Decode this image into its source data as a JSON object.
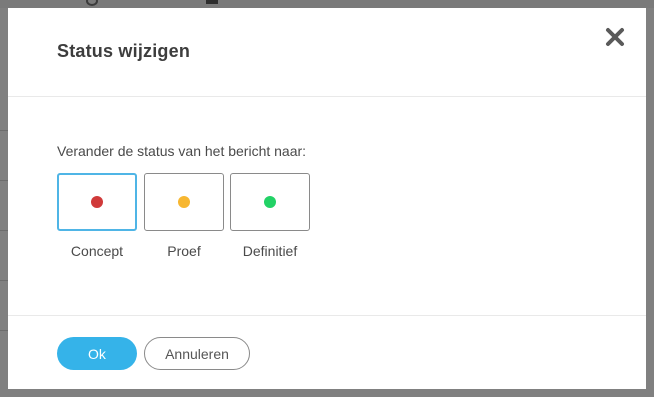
{
  "dialog": {
    "title": "Status wijzigen",
    "close_icon": "close-icon",
    "prompt": "Verander de status van het bericht naar:",
    "options": [
      {
        "label": "Concept",
        "color": "#d03a3a",
        "selected": true
      },
      {
        "label": "Proef",
        "color": "#f7b731",
        "selected": false
      },
      {
        "label": "Definitief",
        "color": "#22d266",
        "selected": false
      }
    ],
    "ok_label": "Ok",
    "cancel_label": "Annuleren"
  },
  "colors": {
    "accent": "#35b3e9",
    "selected_border": "#4fb5e6",
    "overlay": "#808080"
  }
}
